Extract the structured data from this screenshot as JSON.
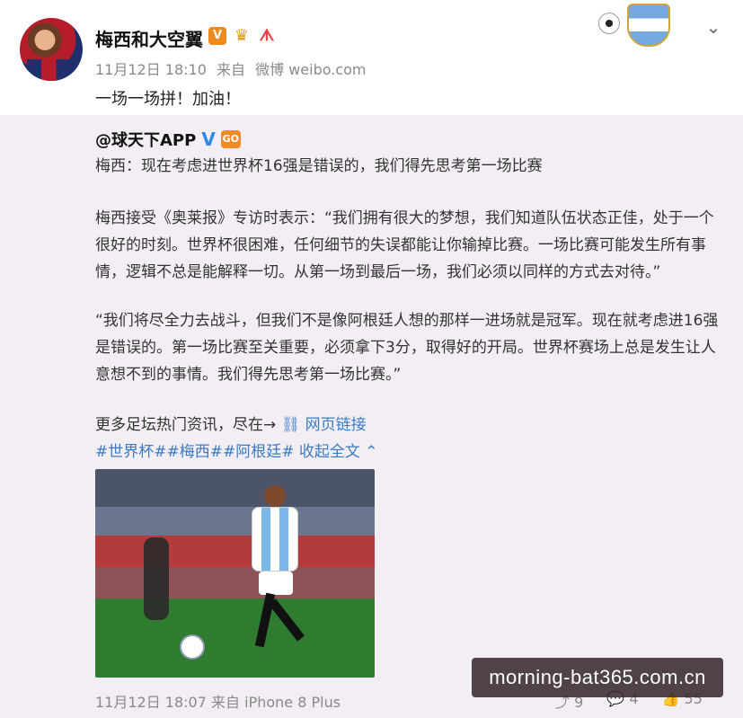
{
  "post": {
    "author": "梅西和大空翼",
    "badge_v": "V",
    "badge_crown": "♛",
    "badge_a": "ᗑ",
    "date": "11月12日 18:10",
    "source_prefix": "来自",
    "source": "微博 weibo.com",
    "text": "一场一场拼！加油！"
  },
  "repost": {
    "author": "@球天下APP",
    "verified": "V",
    "tag": "GO",
    "paragraphs": [
      "梅西：现在考虑进世界杯16强是错误的，我们得先思考第一场比赛",
      "梅西接受《奥莱报》专访时表示：“我们拥有很大的梦想，我们知道队伍状态正佳，处于一个很好的时刻。世界杯很困难，任何细节的失误都能让你输掉比赛。一场比赛可能发生所有事情，逻辑不总是能解释一切。从第一场到最后一场，我们必须以同样的方式去对待。”",
      "“我们将尽全力去战斗，但我们不是像阿根廷人想的那样一进场就是冠军。现在就考虑进16强是错误的。第一场比赛至关重要，必须拿下3分，取得好的开局。世界杯赛场上总是发生让人意想不到的事情。我们得先思考第一场比赛。”"
    ],
    "more_text": "更多足坛热门资讯，尽在→",
    "link_text": "网页链接",
    "tags": "#世界杯##梅西##阿根廷#",
    "collapse": "收起全文",
    "date": "11月12日 18:07",
    "source_prefix": "来自",
    "source": "iPhone 8 Plus",
    "stats": {
      "reposts": "9",
      "comments": "4",
      "likes": "55"
    }
  },
  "watermark": "morning-bat365.com.cn"
}
